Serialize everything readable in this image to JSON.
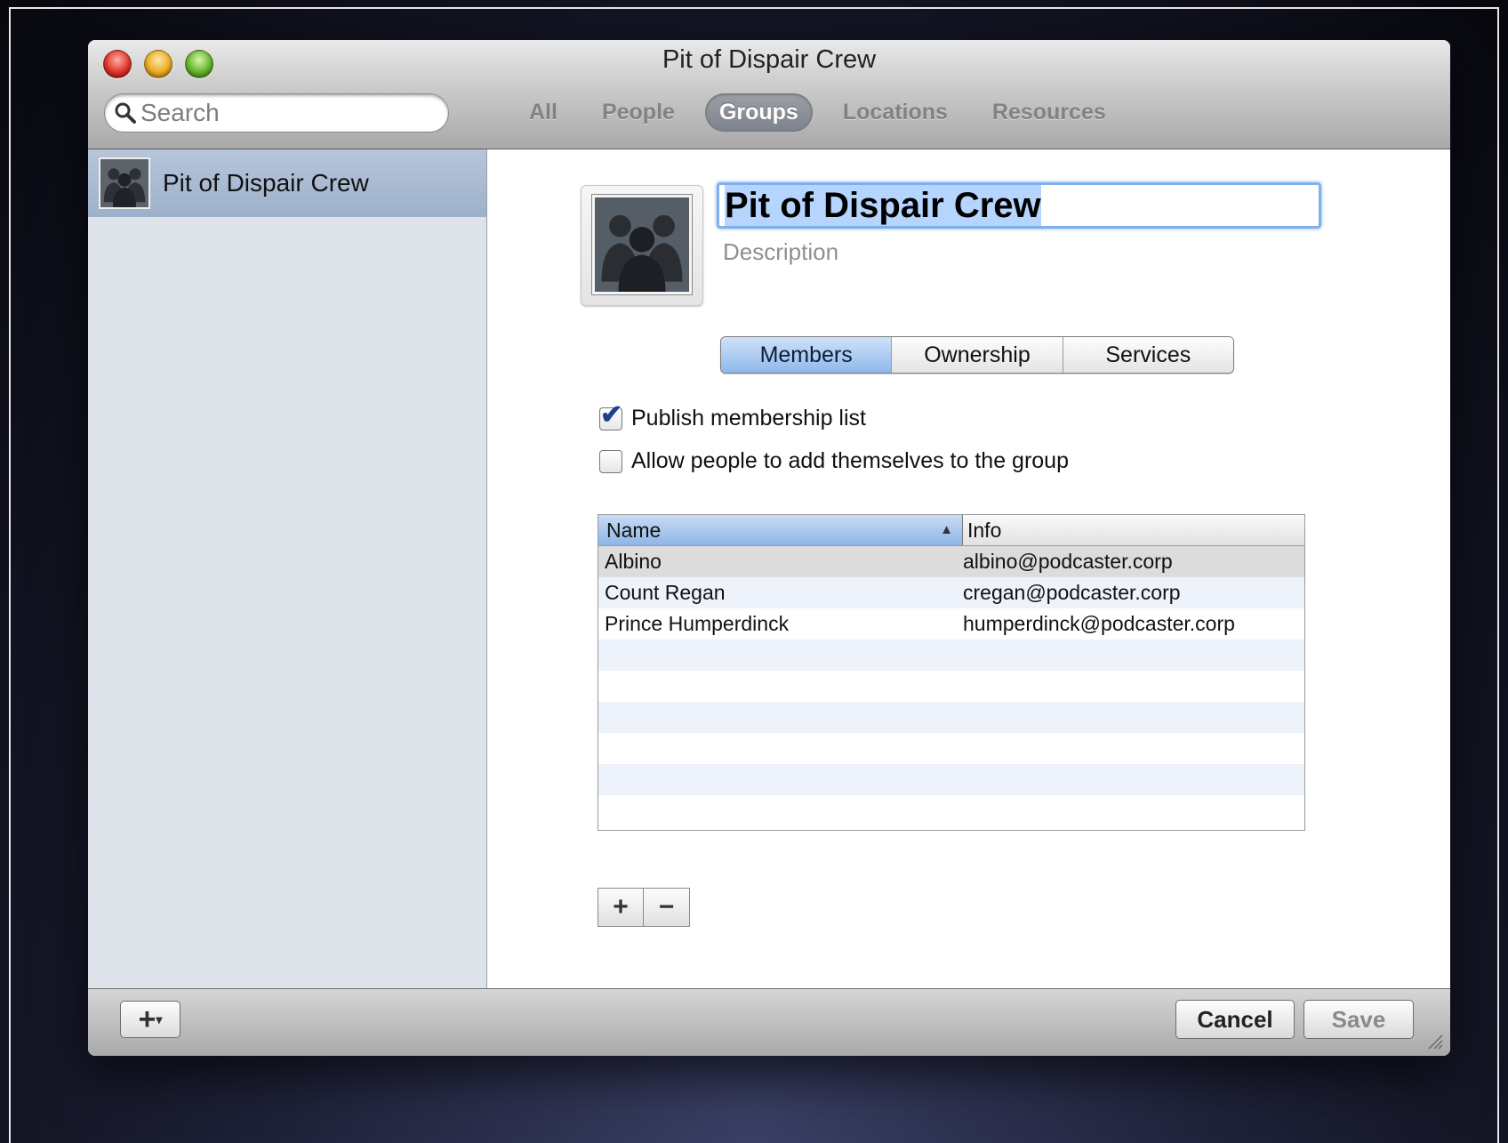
{
  "window": {
    "title": "Pit of Dispair Crew"
  },
  "search": {
    "placeholder": "Search"
  },
  "scopes": [
    "All",
    "People",
    "Groups",
    "Locations",
    "Resources"
  ],
  "scope_active": "Groups",
  "sidebar": {
    "items": [
      {
        "label": "Pit of Dispair Crew",
        "icon": "group-icon",
        "selected": true
      }
    ]
  },
  "detail": {
    "name": "Pit of Dispair Crew",
    "description_placeholder": "Description",
    "tabs": [
      "Members",
      "Ownership",
      "Services"
    ],
    "active_tab": "Members",
    "checkboxes": [
      {
        "label": "Publish membership list",
        "checked": true
      },
      {
        "label": "Allow people to add themselves to the group",
        "checked": false
      }
    ],
    "table": {
      "columns": [
        "Name",
        "Info"
      ],
      "sort_indicator": "▲",
      "rows": [
        {
          "name": "Albino",
          "info": "albino@podcaster.corp"
        },
        {
          "name": "Count Regan",
          "info": "cregan@podcaster.corp"
        },
        {
          "name": "Prince Humperdinck",
          "info": "humperdinck@podcaster.corp"
        }
      ]
    },
    "add_symbol": "+",
    "remove_symbol": "−"
  },
  "footer": {
    "add_symbol": "+",
    "cancel_label": "Cancel",
    "save_label": "Save"
  }
}
